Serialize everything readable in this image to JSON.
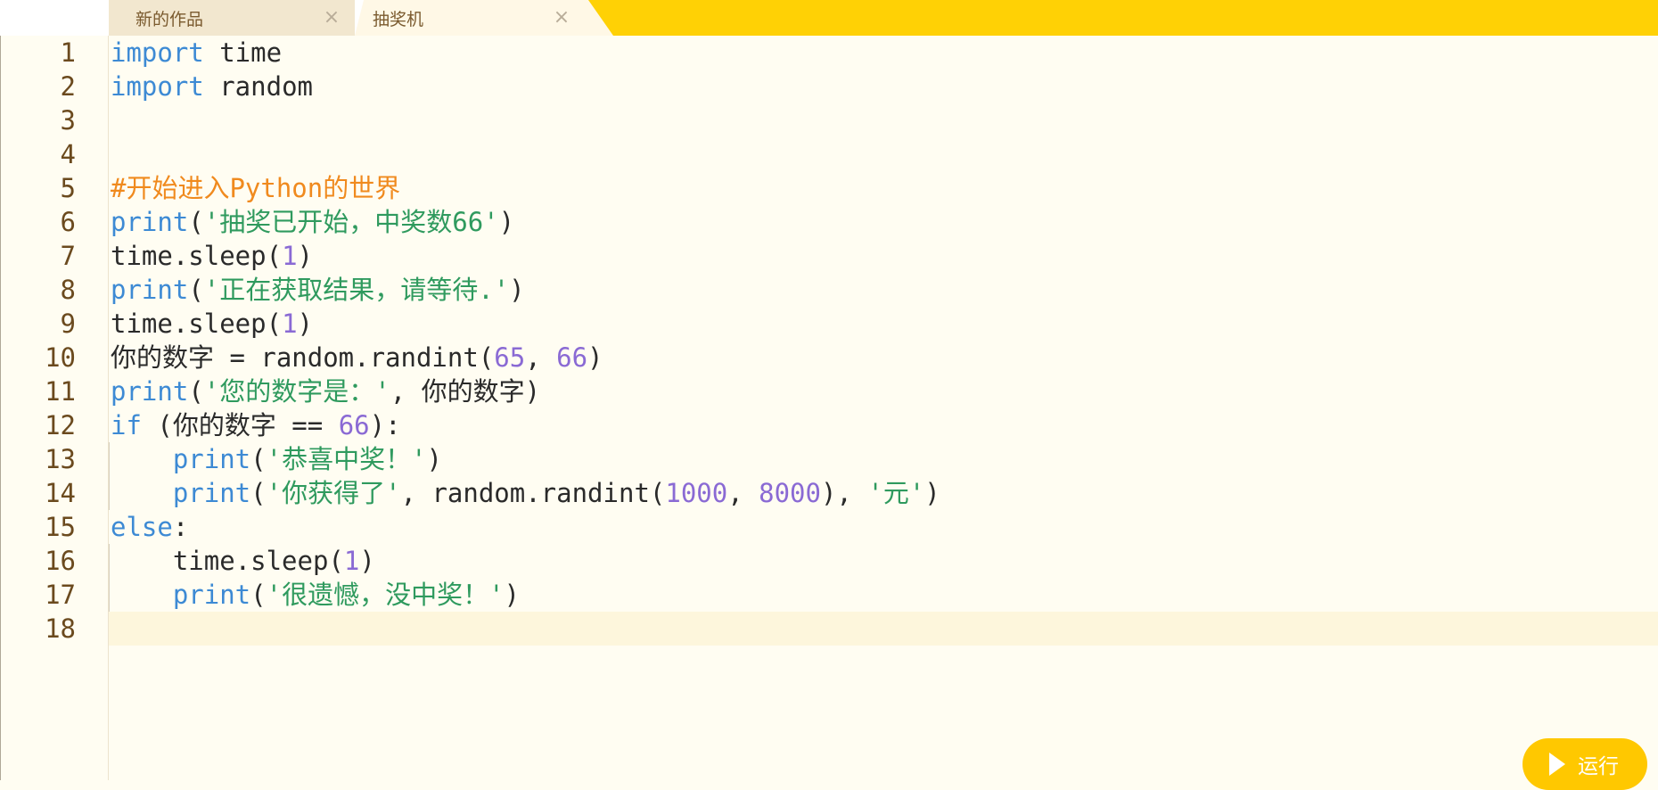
{
  "tabs": [
    {
      "label": "新的作品",
      "close": "×"
    },
    {
      "label": "抽奖机",
      "close": "×"
    }
  ],
  "editor": {
    "current_line": 18,
    "lines": [
      {
        "n": "1",
        "tokens": [
          {
            "t": "import",
            "c": "kw"
          },
          {
            "t": " time",
            "c": "id"
          }
        ]
      },
      {
        "n": "2",
        "tokens": [
          {
            "t": "import",
            "c": "kw"
          },
          {
            "t": " random",
            "c": "id"
          }
        ]
      },
      {
        "n": "3",
        "tokens": []
      },
      {
        "n": "4",
        "tokens": []
      },
      {
        "n": "5",
        "tokens": [
          {
            "t": "#开始进入Python的世界",
            "c": "cmt"
          }
        ]
      },
      {
        "n": "6",
        "tokens": [
          {
            "t": "print",
            "c": "fn"
          },
          {
            "t": "(",
            "c": "id"
          },
          {
            "t": "'抽奖已开始，中奖数66'",
            "c": "str"
          },
          {
            "t": ")",
            "c": "id"
          }
        ]
      },
      {
        "n": "7",
        "tokens": [
          {
            "t": "time.sleep(",
            "c": "id"
          },
          {
            "t": "1",
            "c": "num"
          },
          {
            "t": ")",
            "c": "id"
          }
        ]
      },
      {
        "n": "8",
        "tokens": [
          {
            "t": "print",
            "c": "fn"
          },
          {
            "t": "(",
            "c": "id"
          },
          {
            "t": "'正在获取结果，请等待.'",
            "c": "str"
          },
          {
            "t": ")",
            "c": "id"
          }
        ]
      },
      {
        "n": "9",
        "tokens": [
          {
            "t": "time.sleep(",
            "c": "id"
          },
          {
            "t": "1",
            "c": "num"
          },
          {
            "t": ")",
            "c": "id"
          }
        ]
      },
      {
        "n": "10",
        "tokens": [
          {
            "t": "你的数字 = random.randint(",
            "c": "id"
          },
          {
            "t": "65",
            "c": "num"
          },
          {
            "t": ", ",
            "c": "id"
          },
          {
            "t": "66",
            "c": "num"
          },
          {
            "t": ")",
            "c": "id"
          }
        ]
      },
      {
        "n": "11",
        "tokens": [
          {
            "t": "print",
            "c": "fn"
          },
          {
            "t": "(",
            "c": "id"
          },
          {
            "t": "'您的数字是：'",
            "c": "str"
          },
          {
            "t": ", 你的数字)",
            "c": "id"
          }
        ]
      },
      {
        "n": "12",
        "tokens": [
          {
            "t": "if",
            "c": "kw"
          },
          {
            "t": " (你的数字 == ",
            "c": "id"
          },
          {
            "t": "66",
            "c": "num"
          },
          {
            "t": "):",
            "c": "id"
          }
        ]
      },
      {
        "n": "13",
        "indent": true,
        "tokens": [
          {
            "t": "    ",
            "c": "id"
          },
          {
            "t": "print",
            "c": "fn"
          },
          {
            "t": "(",
            "c": "id"
          },
          {
            "t": "'恭喜中奖！'",
            "c": "str"
          },
          {
            "t": ")",
            "c": "id"
          }
        ]
      },
      {
        "n": "14",
        "indent": true,
        "tokens": [
          {
            "t": "    ",
            "c": "id"
          },
          {
            "t": "print",
            "c": "fn"
          },
          {
            "t": "(",
            "c": "id"
          },
          {
            "t": "'你获得了'",
            "c": "str"
          },
          {
            "t": ", random.randint(",
            "c": "id"
          },
          {
            "t": "1000",
            "c": "num"
          },
          {
            "t": ", ",
            "c": "id"
          },
          {
            "t": "8000",
            "c": "num"
          },
          {
            "t": "), ",
            "c": "id"
          },
          {
            "t": "'元'",
            "c": "str"
          },
          {
            "t": ")",
            "c": "id"
          }
        ]
      },
      {
        "n": "15",
        "tokens": [
          {
            "t": "else",
            "c": "kw"
          },
          {
            "t": ":",
            "c": "id"
          }
        ]
      },
      {
        "n": "16",
        "indent": true,
        "tokens": [
          {
            "t": "    time.sleep(",
            "c": "id"
          },
          {
            "t": "1",
            "c": "num"
          },
          {
            "t": ")",
            "c": "id"
          }
        ]
      },
      {
        "n": "17",
        "indent": true,
        "tokens": [
          {
            "t": "    ",
            "c": "id"
          },
          {
            "t": "print",
            "c": "fn"
          },
          {
            "t": "(",
            "c": "id"
          },
          {
            "t": "'很遗憾，没中奖！'",
            "c": "str"
          },
          {
            "t": ")",
            "c": "id"
          }
        ]
      },
      {
        "n": "18",
        "tokens": []
      }
    ]
  },
  "run_button": {
    "label": "运行",
    "icon": "play-icon"
  },
  "colors": {
    "accent": "#ffd105",
    "keyword": "#3d8ad4",
    "string": "#2f9a5e",
    "number": "#8a6ad4",
    "comment": "#f08a1e",
    "line_number": "#6b4a1e"
  }
}
